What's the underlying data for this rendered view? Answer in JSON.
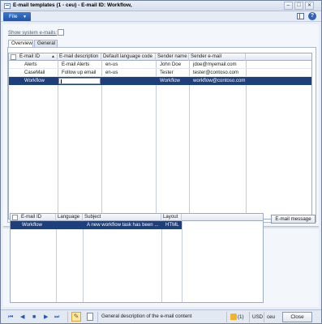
{
  "window": {
    "title": "E-mail templates (1 - ceu) - E-mail ID: Workflow,",
    "minimize_glyph": "–",
    "maximize_glyph": "□",
    "close_glyph": "✕"
  },
  "menubar": {
    "file_label": "File",
    "file_caret": "▼",
    "help_glyph": "?"
  },
  "options": {
    "show_system_emails_label": "Show system e-mails:",
    "show_system_emails_checked": false
  },
  "tabs": [
    {
      "label": "Overview",
      "active": true
    },
    {
      "label": "General",
      "active": false
    }
  ],
  "templates_grid": {
    "columns": [
      "E-mail ID",
      "E-mail description",
      "Default language code",
      "Sender name",
      "Sender e-mail"
    ],
    "sort_indicator": "▲",
    "rows": [
      {
        "id": "Alerts",
        "description": "E-mail Alerts",
        "language": "en-us",
        "sender_name": "John Doe",
        "sender_email": "jdoe@myemail.com",
        "selected": false
      },
      {
        "id": "CaseMail",
        "description": "Follow up email",
        "language": "en-us",
        "sender_name": "Tester",
        "sender_email": "tester@contoso.com",
        "selected": false
      },
      {
        "id": "Workflow",
        "description": "",
        "language": "",
        "sender_name": "Workflow",
        "sender_email": "workflow@contoso.com",
        "selected": true
      }
    ]
  },
  "messages_grid": {
    "columns": [
      "E-mail ID",
      "Language",
      "Subject",
      "Layout"
    ],
    "rows": [
      {
        "id": "Workflow",
        "language": "",
        "subject": "A new workflow task has been ...",
        "layout": "HTML",
        "selected": true
      }
    ]
  },
  "email_message_button_label": "E-mail message",
  "statusbar": {
    "nav_first": "⏮",
    "nav_prev": "◀",
    "nav_stop": "■",
    "nav_next": "▶",
    "nav_last": "⏭",
    "help_text": "General description of the e-mail content",
    "notification_count": "(1)",
    "currency": "USD",
    "company": "ceu",
    "close_label": "Close"
  },
  "colors": {
    "selection": "#1d3f7e",
    "file_button": "#1e54a8"
  }
}
